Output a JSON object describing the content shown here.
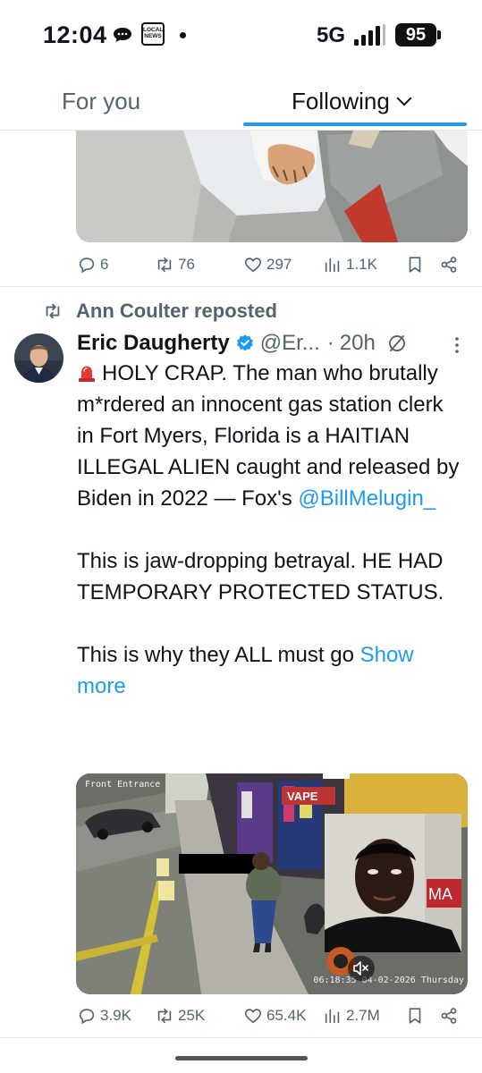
{
  "status_bar": {
    "time": "12:04",
    "news_icon_text": "LOCAL NEWS",
    "network": "5G",
    "battery": "95"
  },
  "tabs": [
    {
      "label": "For you",
      "active": false
    },
    {
      "label": "Following",
      "active": true
    }
  ],
  "accent_color": "#1d9bf0",
  "previous_tweet": {
    "replies": "6",
    "reposts": "76",
    "likes": "297",
    "views": "1.1K"
  },
  "repost_banner": "Ann Coulter reposted",
  "tweet": {
    "author": "Eric Daugherty",
    "verified": true,
    "handle": "@Er...",
    "separator": "·",
    "time": "20h",
    "text_1": "HOLY CRAP. The man who brutally m*rdered an innocent gas station clerk in Fort Myers, Florida is a HAITIAN ILLEGAL ALIEN caught and released by Biden in 2022 — Fox's",
    "mention": "@BillMelugin_",
    "text_2": "This is jaw-dropping betrayal. HE HAD TEMPORARY PROTECTED STATUS.",
    "text_3": "This is why they ALL must go",
    "show_more": "Show more",
    "video": {
      "caption_top_left": "Front Entrance",
      "caption_bottom": "06:18:35 04-02-2026 Thursday",
      "store_sign": "VAPE",
      "inset_sign": "MA"
    },
    "stats": {
      "replies": "3.9K",
      "reposts": "25K",
      "likes": "65.4K",
      "views": "2.7M"
    }
  }
}
